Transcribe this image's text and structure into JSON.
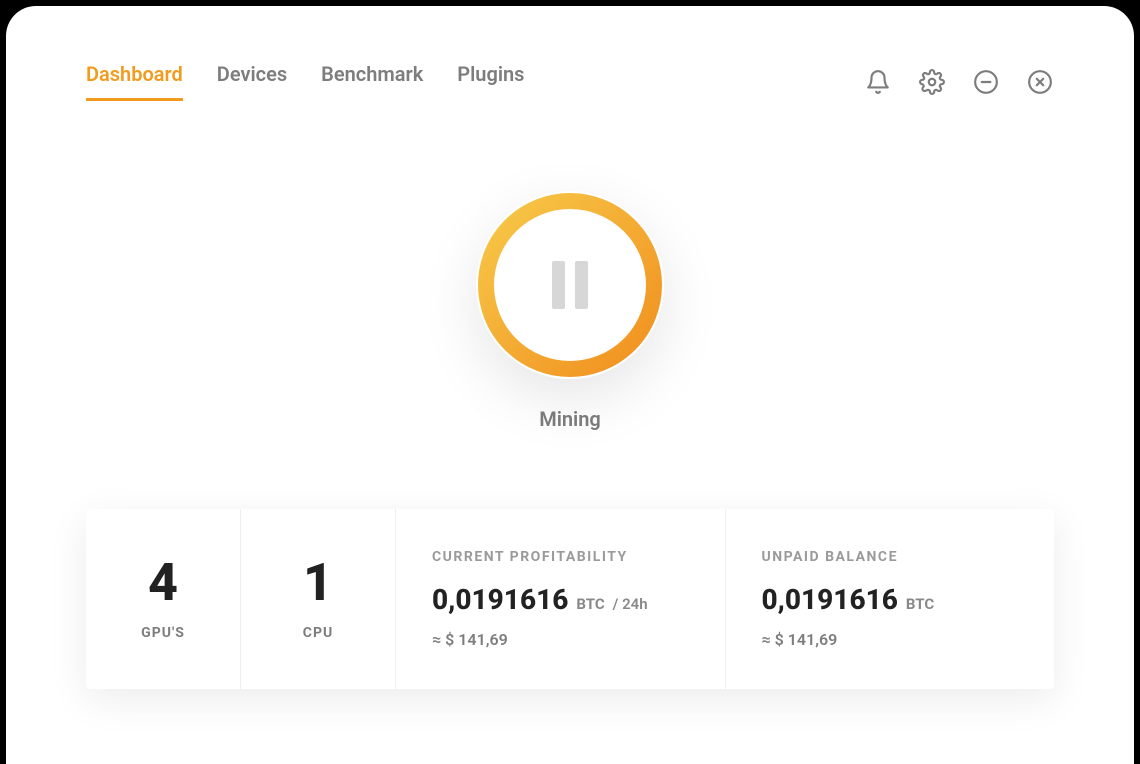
{
  "tabs": {
    "dashboard": "Dashboard",
    "devices": "Devices",
    "benchmark": "Benchmark",
    "plugins": "Plugins"
  },
  "mining": {
    "status_label": "Mining"
  },
  "stats": {
    "gpu": {
      "count": "4",
      "label": "GPU'S"
    },
    "cpu": {
      "count": "1",
      "label": "CPU"
    },
    "profitability": {
      "title": "CURRENT PROFITABILITY",
      "value": "0,0191616",
      "unit": "BTC",
      "per": "/ 24h",
      "fiat": "≈ $ 141,69"
    },
    "balance": {
      "title": "UNPAID BALANCE",
      "value": "0,0191616",
      "unit": "BTC",
      "fiat": "≈ $ 141,69"
    }
  }
}
